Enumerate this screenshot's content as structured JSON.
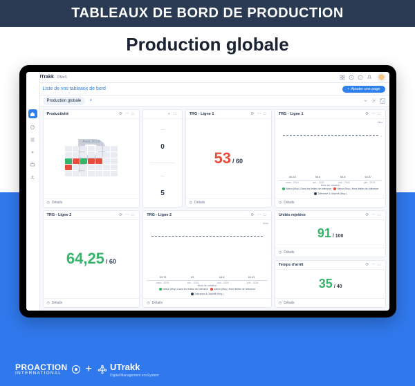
{
  "banner": "TABLEAUX DE BORD DE PRODUCTION",
  "subtitle": "Production globale",
  "topbar": {
    "brand": "UTrakk",
    "brand_sub": "DMeS"
  },
  "header": {
    "title": "Liste de vos tableaux de bord",
    "add_page": "Ajouter une page"
  },
  "tabrow": {
    "tab1": "Production globale"
  },
  "cards": {
    "productivite": {
      "title": "Productivité",
      "month": "Août 2019",
      "details": "Détails"
    },
    "statbox": {
      "val1": "0",
      "val2": "5"
    },
    "trg_l1_num": {
      "title": "TRG - Ligne 1",
      "value": "53",
      "denom": "/ 60",
      "details": "Détails"
    },
    "trg_l1_chart": {
      "title": "TRG - Ligne 1",
      "details": "Détails",
      "max": "Max."
    },
    "trg_l2_num": {
      "title": "TRG - Ligne 2",
      "value": "64,25",
      "denom": "/ 60",
      "details": "Détails"
    },
    "trg_l2_chart": {
      "title": "TRG - Ligne 2",
      "details": "Détails",
      "max": "Max."
    },
    "unites": {
      "title": "Unités rejetées",
      "value": "91",
      "denom": "/ 100",
      "details": "Détails"
    },
    "temps": {
      "title": "Temps d'arrêt",
      "value": "35",
      "denom": "/ 40",
      "details": "Détails"
    }
  },
  "chart_data": [
    {
      "type": "bar",
      "card": "trg_l1_chart",
      "categories": [
        "mars - 2024",
        "avr. - 2024",
        "mai - 2024",
        "juin - 2024"
      ],
      "values": [
        66.43,
        56.6,
        64.8,
        64.57
      ],
      "tolerance_upper": 60,
      "target": 60,
      "colors": [
        "g",
        "r",
        "g",
        "g"
      ],
      "xlabel": "Mois de création",
      "legend": [
        "Valeur (Moy.) Dans les limites de tolérance",
        "Valeur (Moy.) Hors limites de tolérance",
        "Tolérance & Objectif (Moy.)"
      ],
      "ylim": [
        0,
        80
      ]
    },
    {
      "type": "bar",
      "card": "trg_l2_chart",
      "categories": [
        "mars - 2024",
        "avr. - 2024",
        "mai - 2024",
        "juin - 2024"
      ],
      "values": [
        59.75,
        63.0,
        64.8,
        69.43
      ],
      "tolerance_upper": 60,
      "target": 60,
      "colors": [
        "r",
        "g",
        "g",
        "g"
      ],
      "xlabel": "Mois de création",
      "legend": [
        "Valeur (Moy.) Dans les limites de tolérance",
        "Valeur (Moy.) Hors limites de tolérance",
        "Tolérance & Objectif (Moy.)"
      ],
      "ylim": [
        0,
        80
      ]
    }
  ],
  "colors": {
    "green": "#35b56a",
    "red": "#e74c3c",
    "blue": "#2f80ed",
    "navy": "#2a3a52"
  },
  "footer": {
    "proaction_l1": "PROACTION",
    "proaction_l2": "INTERNATIONAL",
    "plus": "+",
    "utrakk": "UTrakk",
    "utrakk_sub": "Digital Management ecoSystem"
  }
}
